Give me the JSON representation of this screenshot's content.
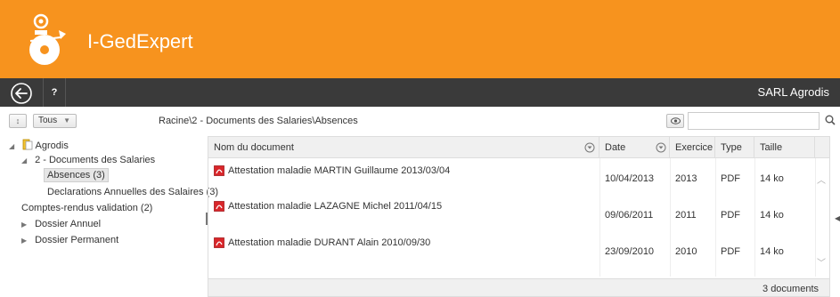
{
  "header": {
    "app_title": "I-GedExpert"
  },
  "toolbar": {
    "help_label": "?",
    "company_name": "SARL Agrodis"
  },
  "filterbar": {
    "sort_label": "↕",
    "filter_value": "Tous",
    "breadcrumb": "Racine\\2 - Documents des Salaries\\Absences",
    "search_placeholder": ""
  },
  "tree": {
    "root": "Agrodis",
    "documents_salaries": "2 - Documents des Salaries",
    "absences": "Absences (3)",
    "declarations": "Declarations Annuelles des Salaires (3)",
    "comptes_rendus": "Comptes-rendus validation (2)",
    "dossier_annuel": "Dossier Annuel",
    "dossier_permanent": "Dossier Permanent"
  },
  "grid": {
    "columns": {
      "name": "Nom du document",
      "date": "Date",
      "exercice": "Exercice",
      "type": "Type",
      "taille": "Taille"
    },
    "rows": [
      {
        "name": "Attestation maladie MARTIN Guillaume 2013/03/04",
        "date": "10/04/2013",
        "exercice": "2013",
        "type": "PDF",
        "taille": "14 ko"
      },
      {
        "name": "Attestation maladie LAZAGNE Michel 2011/04/15",
        "date": "09/06/2011",
        "exercice": "2011",
        "type": "PDF",
        "taille": "14 ko"
      },
      {
        "name": "Attestation maladie DURANT Alain 2010/09/30",
        "date": "23/09/2010",
        "exercice": "2010",
        "type": "PDF",
        "taille": "14 ko"
      }
    ],
    "footer": "3 documents"
  },
  "colors": {
    "header_bg": "#f7931e",
    "toolbar_bg": "#3a3a3a",
    "pdf_red": "#d9262a"
  }
}
